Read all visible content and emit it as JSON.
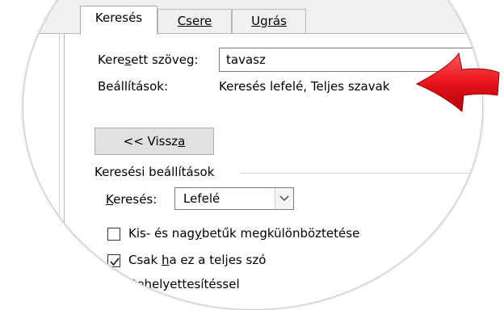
{
  "tabs": [
    {
      "label": "Keresés",
      "underline_index": 6
    },
    {
      "label": "Csere",
      "underline_index": 0
    },
    {
      "label": "Ugrás",
      "underline_index": 0
    }
  ],
  "search": {
    "label_pre": "Kere",
    "label_u": "s",
    "label_post": "ett szöveg:",
    "value": "tavasz"
  },
  "settings": {
    "label": "Beállítások:",
    "value": "Keresés lefelé, Teljes szavak"
  },
  "back_button": {
    "pre": "<< Vissz",
    "u": "a"
  },
  "options_group": {
    "title": "Keresési beállítások"
  },
  "direction": {
    "label_pre": "",
    "label_u": "K",
    "label_post": "eresés:",
    "value": "Lefelé"
  },
  "options": [
    {
      "pre": "Kis- és nag",
      "u": "y",
      "post": "betűk megkülönböztetése",
      "checked": false
    },
    {
      "pre": "Csak ",
      "u": "h",
      "post": "a ez a teljes szó",
      "checked": true
    },
    {
      "pre": "",
      "u": "B",
      "post": "ehelyettesítéssel",
      "checked": false
    }
  ],
  "colors": {
    "arrow": "#e8141b",
    "panel": "#ffffff",
    "tabs": "#f0f0f0"
  }
}
